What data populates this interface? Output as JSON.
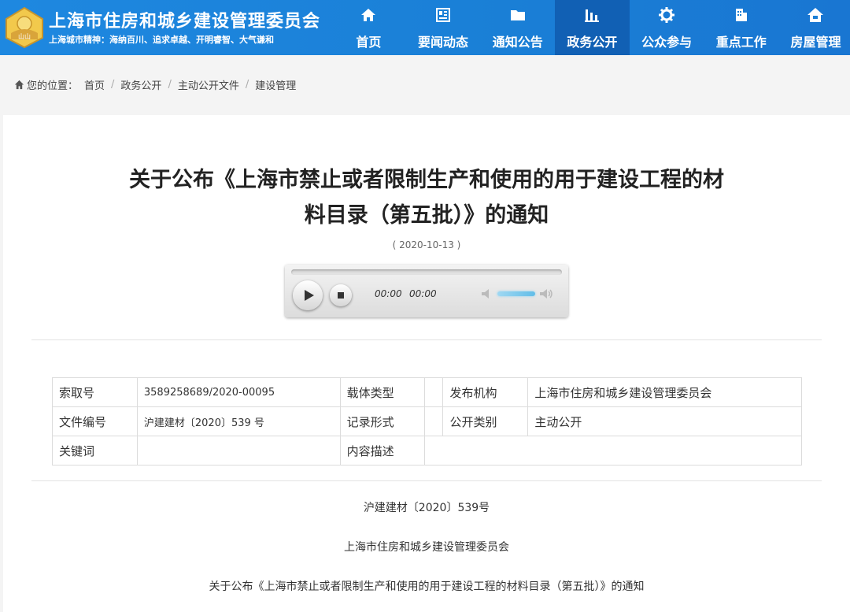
{
  "header": {
    "site_title": "上海市住房和城乡建设管理委员会",
    "site_motto": "上海城市精神：海纳百川、追求卓越、开明睿智、大气谦和",
    "logo_text": "山山",
    "nav": [
      {
        "label": "首页",
        "icon": "home-icon"
      },
      {
        "label": "要闻动态",
        "icon": "news-icon"
      },
      {
        "label": "通知公告",
        "icon": "folder-icon"
      },
      {
        "label": "政务公开",
        "icon": "bar-chart-icon",
        "active": true
      },
      {
        "label": "公众参与",
        "icon": "gear-icon"
      },
      {
        "label": "重点工作",
        "icon": "building-icon"
      },
      {
        "label": "房屋管理",
        "icon": "house-icon"
      }
    ]
  },
  "breadcrumb": {
    "prefix": "您的位置：",
    "items": [
      "首页",
      "政务公开",
      "主动公开文件",
      "建设管理"
    ]
  },
  "article": {
    "title_line1": "关于公布《上海市禁止或者限制生产和使用的用于建设工程的材",
    "title_line2": "料目录（第五批）》的通知",
    "date": "( 2020-10-13 )"
  },
  "player": {
    "current_time": "00:00",
    "duration": "00:00",
    "progress": 0,
    "volume": 0.7
  },
  "info_table": {
    "row1": {
      "l1": "索取号",
      "v1": "3589258689/2020-00095",
      "l2": "载体类型",
      "v2": "",
      "l3": "发布机构",
      "v3": "上海市住房和城乡建设管理委员会"
    },
    "row2": {
      "l1": "文件编号",
      "v1": "沪建建材〔2020〕539 号",
      "l2": "记录形式",
      "v2": "",
      "l3": "公开类别",
      "v3": "主动公开"
    },
    "row3": {
      "l1": "关键词",
      "v1": "",
      "l2": "内容描述",
      "v2": ""
    }
  },
  "body": {
    "doc_number": "沪建建材〔2020〕539号",
    "issuer": "上海市住房和城乡建设管理委员会",
    "subject": "关于公布《上海市禁止或者限制生产和使用的用于建设工程的材料目录（第五批）》的通知"
  },
  "colors": {
    "header_blue": "#1e88e0",
    "nav_active": "#1160b4",
    "logo_gold": "#e0b040"
  }
}
